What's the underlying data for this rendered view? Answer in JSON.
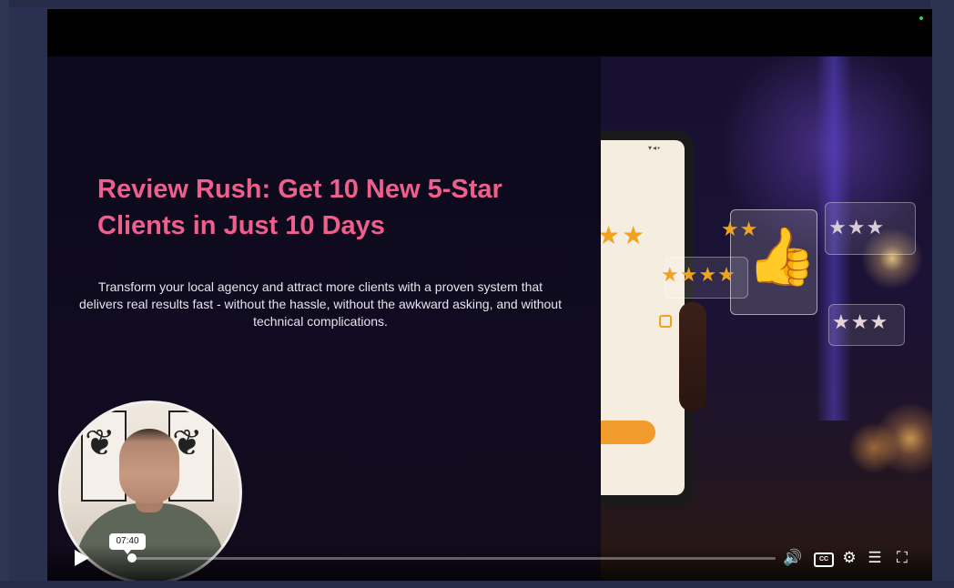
{
  "slide": {
    "title": "Review Rush: Get 10 New 5-Star Clients in Just 10 Days",
    "subtitle": "Transform your local agency and attract more clients with a proven system that delivers real results fast - without the hassle, without the awkward asking, and without technical complications."
  },
  "player": {
    "time_tooltip": "07:40",
    "progress_percent": 0.8,
    "icons": {
      "play": "play-icon",
      "volume": "volume-icon",
      "captions": "captions-icon",
      "settings": "gear-icon",
      "chapters": "chapters-icon",
      "fullscreen": "fullscreen-icon"
    }
  },
  "colors": {
    "title": "#ee5f8c",
    "star": "#f0a31f",
    "frame": "#2a3050"
  }
}
